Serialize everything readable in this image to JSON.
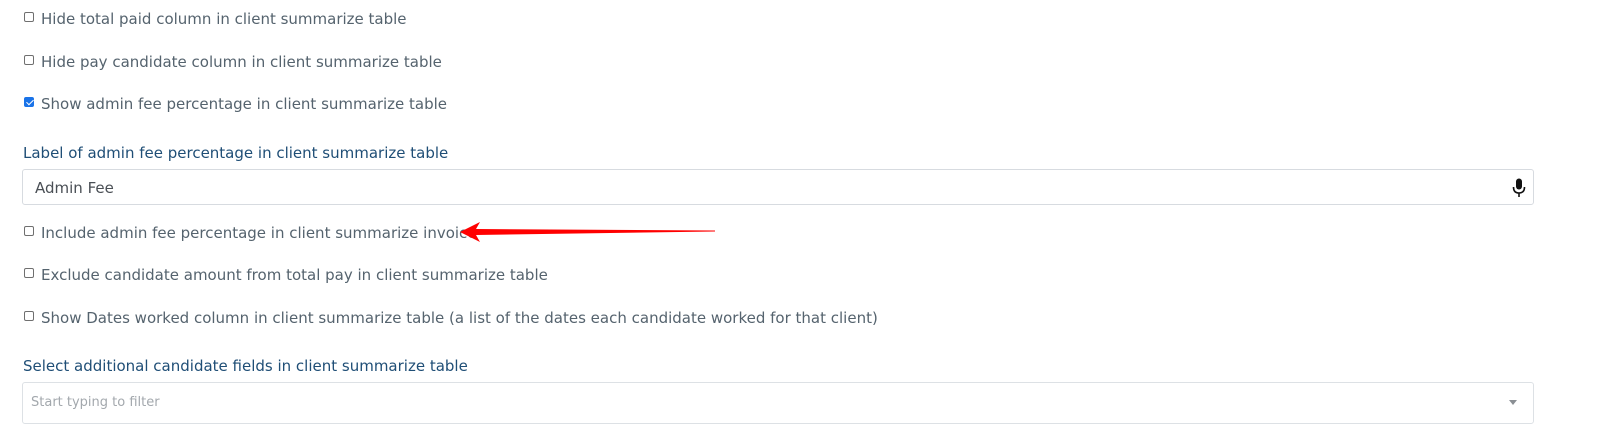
{
  "options": [
    {
      "label": "Hide total paid column in client summarize table",
      "checked": false
    },
    {
      "label": "Hide pay candidate column in client summarize table",
      "checked": false
    },
    {
      "label": "Show admin fee percentage in client summarize table",
      "checked": true
    },
    {
      "label": "Include admin fee percentage in client summarize invoice",
      "checked": false
    },
    {
      "label": "Exclude candidate amount from total pay in client summarize table",
      "checked": false
    },
    {
      "label": "Show Dates worked column in client summarize table (a list of the dates each candidate worked for that client)",
      "checked": false
    }
  ],
  "admin_fee_label": {
    "label": "Label of admin fee percentage in client summarize table",
    "value": "Admin Fee",
    "icon": "microphone-icon"
  },
  "additional_fields": {
    "label": "Select additional candidate fields in client summarize table",
    "placeholder": "Start typing to filter",
    "icon": "caret-down-icon"
  },
  "annotation": {
    "icon": "red-arrow-icon",
    "color": "#ff0000"
  },
  "colors": {
    "checkbox_checked": "#1a73e8",
    "option_text": "#55636e",
    "field_label": "#1f4e76"
  }
}
